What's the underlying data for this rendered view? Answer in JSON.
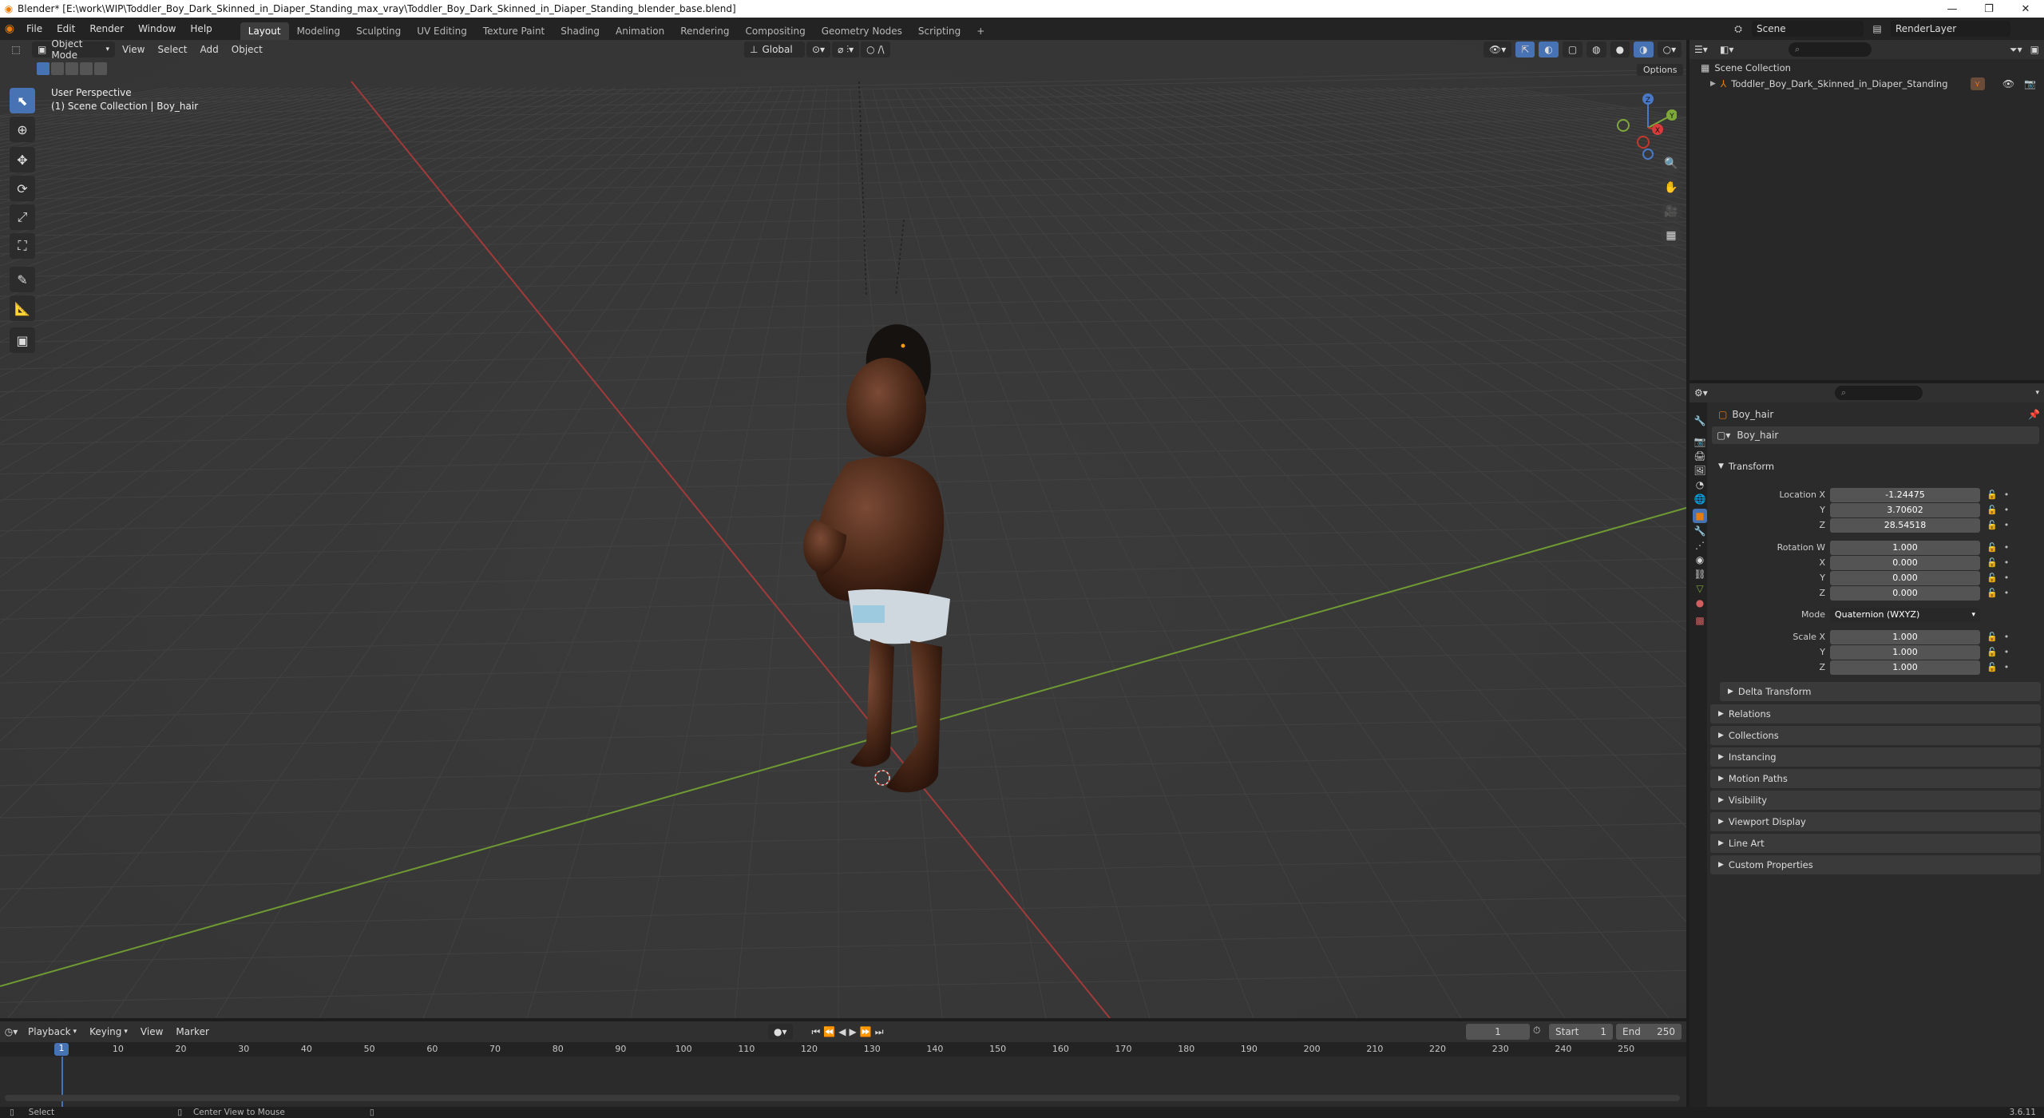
{
  "window": {
    "title": "Blender* [E:\\work\\WIP\\Toddler_Boy_Dark_Skinned_in_Diaper_Standing_max_vray\\Toddler_Boy_Dark_Skinned_in_Diaper_Standing_blender_base.blend]",
    "controls": [
      "—",
      "❐",
      "✕"
    ]
  },
  "menubar": {
    "menus": [
      "File",
      "Edit",
      "Render",
      "Window",
      "Help"
    ],
    "workspaces": [
      "Layout",
      "Modeling",
      "Sculpting",
      "UV Editing",
      "Texture Paint",
      "Shading",
      "Animation",
      "Rendering",
      "Compositing",
      "Geometry Nodes",
      "Scripting"
    ],
    "active_workspace": "Layout",
    "add_tab": "+",
    "scene": "Scene",
    "view_layer": "RenderLayer"
  },
  "viewport": {
    "mode": "Object Mode",
    "menus": [
      "View",
      "Select",
      "Add",
      "Object"
    ],
    "orientation": "Global",
    "options_label": "Options",
    "overlay_title": "User Perspective",
    "overlay_subtitle": "(1) Scene Collection | Boy_hair",
    "gizmo": {
      "x": "X",
      "y": "Y",
      "z": "Z"
    }
  },
  "outliner": {
    "root": "Scene Collection",
    "items": [
      "Toddler_Boy_Dark_Skinned_in_Diaper_Standing"
    ]
  },
  "properties": {
    "object_name": "Boy_hair",
    "data_name": "Boy_hair",
    "transform_title": "Transform",
    "location_label": "Location X",
    "location": {
      "x": "-1.24475",
      "y": "3.70602",
      "z": "28.54518"
    },
    "rotation_label": "Rotation W",
    "rotation": {
      "w": "1.000",
      "x": "0.000",
      "y": "0.000",
      "z": "0.000"
    },
    "axis_labels": {
      "x": "X",
      "y": "Y",
      "z": "Z"
    },
    "mode_label": "Mode",
    "mode_value": "Quaternion (WXYZ)",
    "scale_label": "Scale X",
    "scale": {
      "x": "1.000",
      "y": "1.000",
      "z": "1.000"
    },
    "delta_transform": "Delta Transform",
    "panels": [
      "Relations",
      "Collections",
      "Instancing",
      "Motion Paths",
      "Visibility",
      "Viewport Display",
      "Line Art",
      "Custom Properties"
    ]
  },
  "timeline": {
    "menus": [
      "Playback",
      "Keying",
      "View",
      "Marker"
    ],
    "current_frame": "1",
    "start_label": "Start",
    "start": "1",
    "end_label": "End",
    "end": "250",
    "ticks": [
      "10",
      "20",
      "30",
      "40",
      "50",
      "60",
      "70",
      "80",
      "90",
      "100",
      "110",
      "120",
      "130",
      "140",
      "150",
      "160",
      "170",
      "180",
      "190",
      "200",
      "210",
      "220",
      "230",
      "240",
      "250"
    ],
    "playhead": "1"
  },
  "statusbar": {
    "left": "Select",
    "middle": "Center View to Mouse",
    "version": "3.6.11"
  },
  "colors": {
    "accent": "#4772b3",
    "x_axis": "#c0392b",
    "y_axis": "#7fa83b",
    "object_orange": "#e87d0d"
  }
}
